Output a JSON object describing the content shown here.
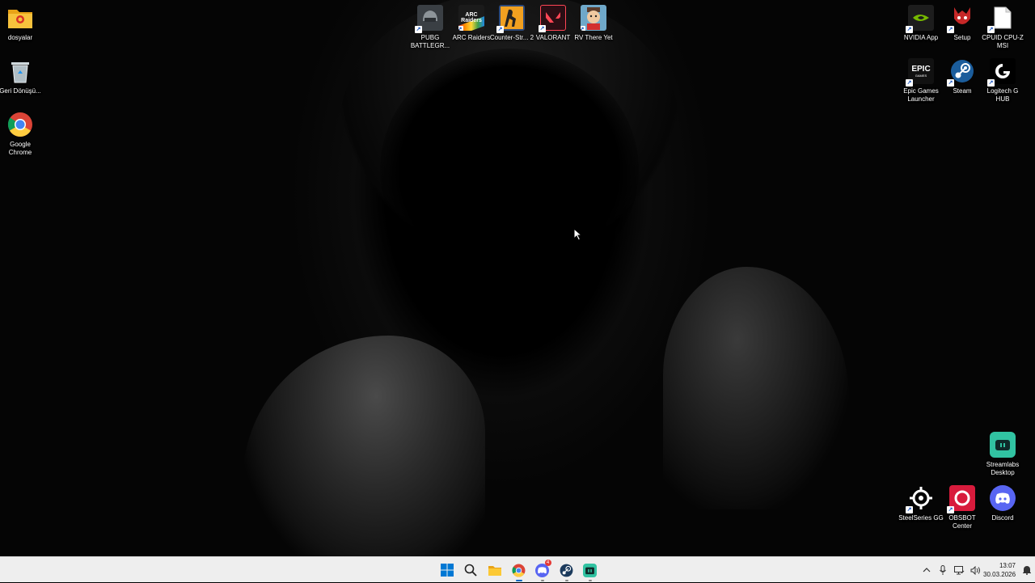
{
  "desktop_icons": {
    "dosyalar": "dosyalar",
    "recycle_bin": "Geri Dönüşü...",
    "chrome": "Google Chrome",
    "pubg": "PUBG BATTLEGR...",
    "arc_raiders": "ARC Raiders",
    "counter_strike": "Counter-Str... 2",
    "valorant": "VALORANT",
    "rv_there_yet": "RV There Yet",
    "nvidia": "NVIDIA App",
    "setup": "Setup",
    "cpuid": "CPUID CPU-Z MSI",
    "epic": "Epic Games Launcher",
    "steam": "Steam",
    "logitech": "Logitech G HUB",
    "streamlabs": "Streamlabs Desktop",
    "steelseries": "SteelSeries GG",
    "obsbot": "OBSBOT Center",
    "discord": "Discord"
  },
  "icon_text": {
    "arc": "ARC Raiders",
    "epic": "EPIC",
    "epic_sub": "GAMES"
  },
  "taskbar": {
    "apps": [
      "start-icon",
      "search-icon",
      "file-explorer-icon",
      "chrome-icon",
      "discord-icon",
      "steam-icon",
      "streamlabs-icon"
    ],
    "discord_badge": "4"
  },
  "tray": {
    "time": "13:07",
    "date": "30.03.2026"
  },
  "colors": {
    "accent": "#0067c0",
    "taskbar_bg": "#eeeeee"
  }
}
